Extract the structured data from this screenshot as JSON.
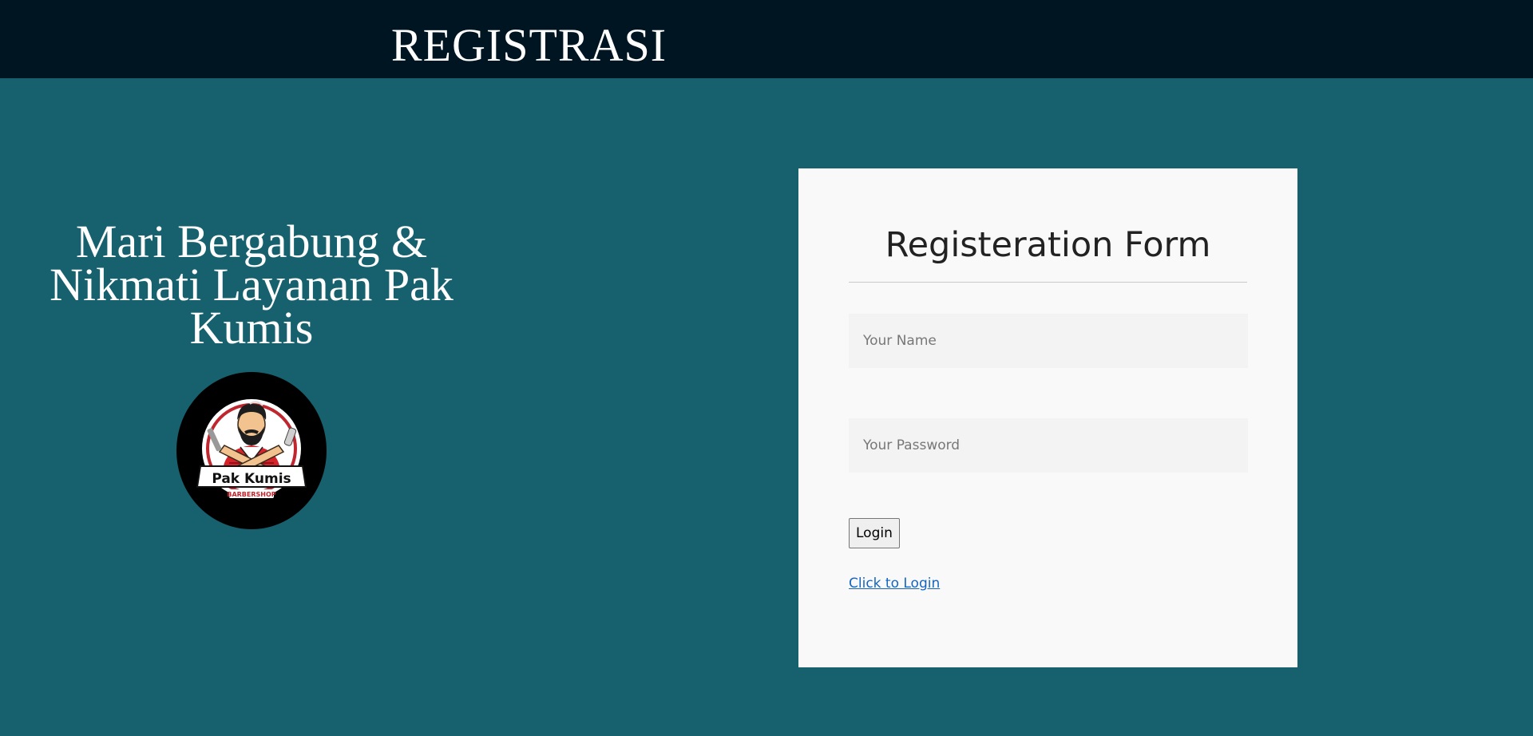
{
  "header": {
    "title": "REGISTRASI"
  },
  "promo": {
    "line1": "Mari Bergabung &",
    "line2": "Nikmati Layanan Pak",
    "line3": "Kumis"
  },
  "logo": {
    "brand_text": "Pak Kumis",
    "sub_text": "BARBERSHOP",
    "icon": "barber-mascot-logo"
  },
  "form": {
    "title": "Registeration Form",
    "name_placeholder": "Your Name",
    "name_value": "",
    "password_placeholder": "Your Password",
    "password_value": "",
    "submit_label": "Login",
    "login_link": "Click to Login"
  },
  "colors": {
    "header_bg": "#001522",
    "page_bg": "#17616e",
    "card_bg": "#f9f9f9",
    "input_bg": "#f3f3f3",
    "link": "#1565c0"
  }
}
